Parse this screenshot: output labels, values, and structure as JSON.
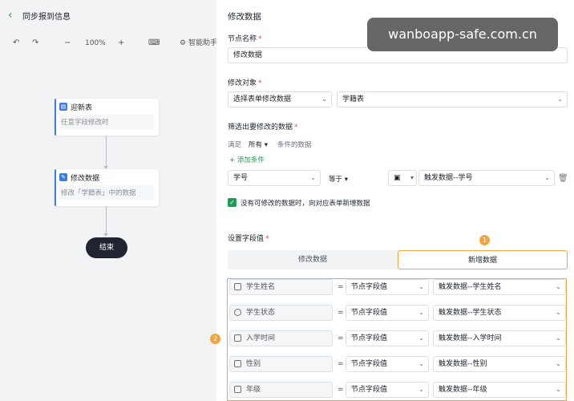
{
  "header": {
    "title": "同步报到信息"
  },
  "toolbar": {
    "zoom": "100%",
    "ai_label": "智能助手"
  },
  "flow": {
    "nodes": [
      {
        "title": "迎新表",
        "desc": "任意字段修改时"
      },
      {
        "title": "修改数据",
        "desc": "修改「学籍表」中的数据"
      }
    ],
    "end_label": "结束"
  },
  "panel": {
    "title": "修改数据",
    "node_name_label": "节点名称",
    "node_name_value": "修改数据",
    "target_label": "修改对象",
    "target_mode": "选择表单修改数据",
    "target_form": "学籍表",
    "filter_label": "筛选出要修改的数据",
    "filter_prefix": "满足",
    "filter_scope": "所有",
    "filter_suffix": "条件的数据",
    "add_condition": "添加条件",
    "condition": {
      "field": "学号",
      "operator": "等于",
      "value": "触发数据--学号"
    },
    "checkbox_label": "没有可修改的数据时，向对应表单新增数据",
    "set_fields_label": "设置字段值",
    "tabs": [
      "修改数据",
      "新增数据"
    ],
    "field_rows": [
      {
        "name": "学生姓名",
        "type": "节点字段值",
        "value": "触发数据--学生姓名"
      },
      {
        "name": "学生状态",
        "type": "节点字段值",
        "value": "触发数据--学生状态"
      },
      {
        "name": "入学时间",
        "type": "节点字段值",
        "value": "触发数据--入学时间"
      },
      {
        "name": "性别",
        "type": "节点字段值",
        "value": "触发数据--性别"
      },
      {
        "name": "年级",
        "type": "节点字段值",
        "value": "触发数据--年级"
      }
    ],
    "eq_symbol": "=",
    "badges": [
      "1",
      "2"
    ]
  },
  "watermark": "wanboapp-safe.com.cn",
  "colors": {
    "accent": "#1f9d55",
    "highlight": "#f0a640",
    "end_node": "#1f2430"
  }
}
